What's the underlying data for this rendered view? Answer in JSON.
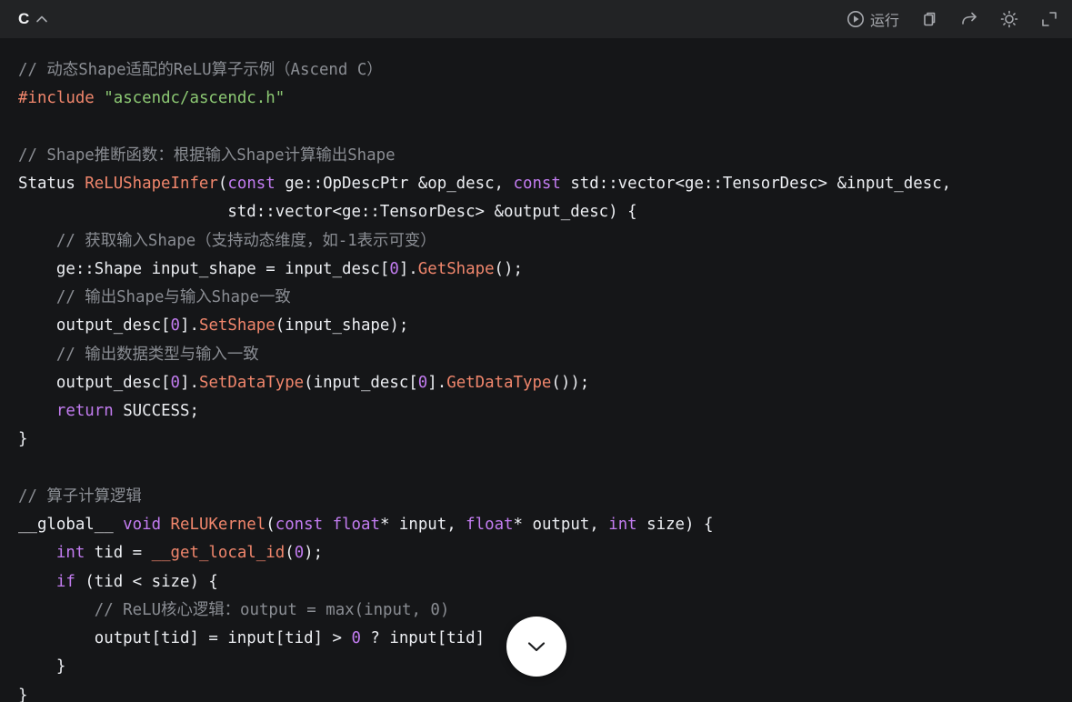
{
  "header": {
    "language_label": "C",
    "collapse_icon": "chevron-up-icon",
    "run_label": "运行",
    "tools": [
      "play-circle-icon",
      "copy-icon",
      "share-icon",
      "theme-sun-icon",
      "fullscreen-icon"
    ]
  },
  "colors": {
    "background": "#151618",
    "header_bg": "#222325",
    "comment": "#8a8d93",
    "keyword": "#c27cf0",
    "function": "#f0866c",
    "string": "#8cc873",
    "text": "#eceef2"
  },
  "code": {
    "lines": [
      [
        {
          "t": "com",
          "v": "// 动态Shape适配的ReLU算子示例（Ascend C）"
        }
      ],
      [
        {
          "t": "pre",
          "v": "#include"
        },
        {
          "t": "id",
          "v": " "
        },
        {
          "t": "str",
          "v": "\"ascendc/ascendc.h\""
        }
      ],
      [],
      [
        {
          "t": "com",
          "v": "// Shape推断函数：根据输入Shape计算输出Shape"
        }
      ],
      [
        {
          "t": "id",
          "v": "Status "
        },
        {
          "t": "fn",
          "v": "ReLUShapeInfer"
        },
        {
          "t": "id",
          "v": "("
        },
        {
          "t": "kw",
          "v": "const"
        },
        {
          "t": "id",
          "v": " ge::OpDescPtr &op_desc, "
        },
        {
          "t": "kw",
          "v": "const"
        },
        {
          "t": "id",
          "v": " std::vector<ge::TensorDesc> &input_desc,"
        }
      ],
      [
        {
          "t": "id",
          "v": "                      std::vector<ge::TensorDesc> &output_desc) {"
        }
      ],
      [
        {
          "t": "id",
          "v": "    "
        },
        {
          "t": "com",
          "v": "// 获取输入Shape（支持动态维度，如-1表示可变）"
        }
      ],
      [
        {
          "t": "id",
          "v": "    ge::Shape input_shape = input_desc["
        },
        {
          "t": "num",
          "v": "0"
        },
        {
          "t": "id",
          "v": "]."
        },
        {
          "t": "fn",
          "v": "GetShape"
        },
        {
          "t": "id",
          "v": "();"
        }
      ],
      [
        {
          "t": "id",
          "v": "    "
        },
        {
          "t": "com",
          "v": "// 输出Shape与输入Shape一致"
        }
      ],
      [
        {
          "t": "id",
          "v": "    output_desc["
        },
        {
          "t": "num",
          "v": "0"
        },
        {
          "t": "id",
          "v": "]."
        },
        {
          "t": "fn",
          "v": "SetShape"
        },
        {
          "t": "id",
          "v": "(input_shape);"
        }
      ],
      [
        {
          "t": "id",
          "v": "    "
        },
        {
          "t": "com",
          "v": "// 输出数据类型与输入一致"
        }
      ],
      [
        {
          "t": "id",
          "v": "    output_desc["
        },
        {
          "t": "num",
          "v": "0"
        },
        {
          "t": "id",
          "v": "]."
        },
        {
          "t": "fn",
          "v": "SetDataType"
        },
        {
          "t": "id",
          "v": "(input_desc["
        },
        {
          "t": "num",
          "v": "0"
        },
        {
          "t": "id",
          "v": "]."
        },
        {
          "t": "fn",
          "v": "GetDataType"
        },
        {
          "t": "id",
          "v": "());"
        }
      ],
      [
        {
          "t": "id",
          "v": "    "
        },
        {
          "t": "kw",
          "v": "return"
        },
        {
          "t": "id",
          "v": " SUCCESS;"
        }
      ],
      [
        {
          "t": "id",
          "v": "}"
        }
      ],
      [],
      [
        {
          "t": "com",
          "v": "// 算子计算逻辑"
        }
      ],
      [
        {
          "t": "id",
          "v": "__global__ "
        },
        {
          "t": "kw",
          "v": "void"
        },
        {
          "t": "id",
          "v": " "
        },
        {
          "t": "fn",
          "v": "ReLUKernel"
        },
        {
          "t": "id",
          "v": "("
        },
        {
          "t": "kw",
          "v": "const"
        },
        {
          "t": "id",
          "v": " "
        },
        {
          "t": "kw",
          "v": "float"
        },
        {
          "t": "id",
          "v": "* input, "
        },
        {
          "t": "kw",
          "v": "float"
        },
        {
          "t": "id",
          "v": "* output, "
        },
        {
          "t": "kw",
          "v": "int"
        },
        {
          "t": "id",
          "v": " size) {"
        }
      ],
      [
        {
          "t": "id",
          "v": "    "
        },
        {
          "t": "kw",
          "v": "int"
        },
        {
          "t": "id",
          "v": " tid = "
        },
        {
          "t": "fn",
          "v": "__get_local_id"
        },
        {
          "t": "id",
          "v": "("
        },
        {
          "t": "num",
          "v": "0"
        },
        {
          "t": "id",
          "v": ");"
        }
      ],
      [
        {
          "t": "id",
          "v": "    "
        },
        {
          "t": "kw",
          "v": "if"
        },
        {
          "t": "id",
          "v": " (tid < size) {"
        }
      ],
      [
        {
          "t": "id",
          "v": "        "
        },
        {
          "t": "com",
          "v": "// ReLU核心逻辑：output = max(input, 0)"
        }
      ],
      [
        {
          "t": "id",
          "v": "        output[tid] = input[tid] > "
        },
        {
          "t": "num",
          "v": "0"
        },
        {
          "t": "id",
          "v": " ? input[tid]       ;"
        }
      ],
      [
        {
          "t": "id",
          "v": "    }"
        }
      ],
      [
        {
          "t": "id",
          "v": "}"
        }
      ]
    ]
  },
  "scroll_button": {
    "icon": "chevron-down-icon"
  }
}
